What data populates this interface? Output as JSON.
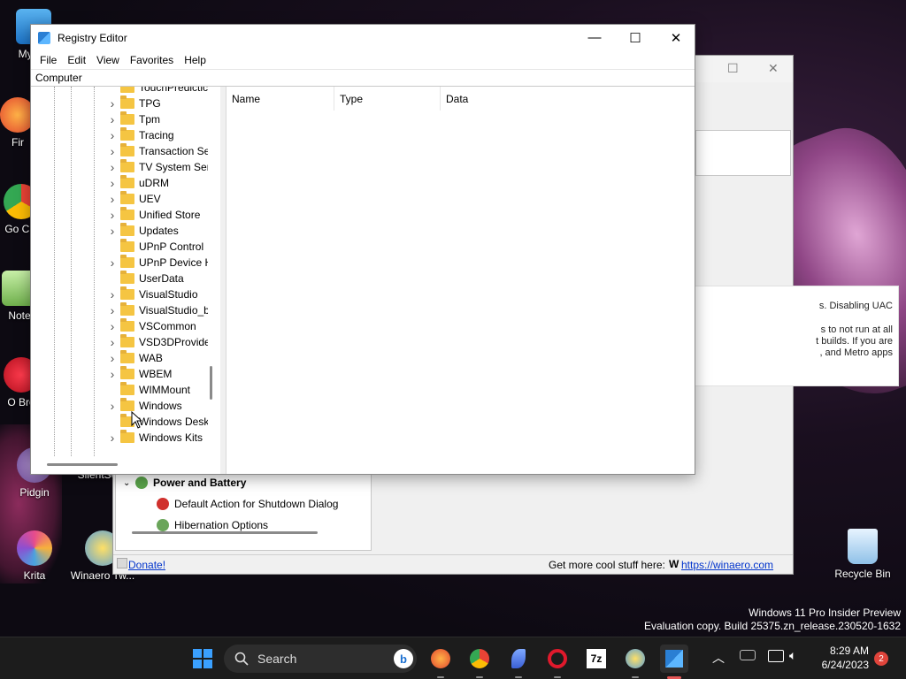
{
  "desktop": {
    "icons": [
      {
        "label": "My Co",
        "icon": "this-pc-icon"
      },
      {
        "label": "Fir",
        "icon": "firefox-icon"
      },
      {
        "label": "Go Chi",
        "icon": "chrome-icon"
      },
      {
        "label": "Note",
        "icon": "notepad-icon"
      },
      {
        "label": "O Bro",
        "icon": "opera-icon"
      },
      {
        "label": "Pidgin",
        "icon": "pidgin-icon"
      },
      {
        "label": "SilentSe",
        "icon": "app-icon"
      },
      {
        "label": "Krita",
        "icon": "krita-icon"
      },
      {
        "label": "Winaero Tw...",
        "icon": "winaero-icon"
      },
      {
        "label": "Recycle Bin",
        "icon": "recycle-bin-icon"
      }
    ],
    "watermark": {
      "line1": "Windows 11 Pro Insider Preview",
      "line2": "Evaluation copy. Build 25375.zn_release.230520-1632"
    }
  },
  "back_window": {
    "tree_section": "Power and Battery",
    "tree_items": [
      "Default Action for Shutdown Dialog",
      "Hibernation Options"
    ],
    "info_text": {
      "line1": "s. Disabling UAC",
      "line2": "s to not run at all",
      "line3": "t builds. If you are",
      "line4": ", and Metro apps"
    },
    "status_left": "Donate!",
    "status_right_text": "Get more cool stuff here:",
    "status_right_link": "https://winaero.com"
  },
  "registry_editor": {
    "title": "Registry Editor",
    "controls": {
      "minimize": "—",
      "maximize": "☐",
      "close": "✕"
    },
    "menu": [
      "File",
      "Edit",
      "View",
      "Favorites",
      "Help"
    ],
    "address": "Computer",
    "tree": [
      {
        "label": "TouchPredictic",
        "expandable": false
      },
      {
        "label": "TPG",
        "expandable": true
      },
      {
        "label": "Tpm",
        "expandable": true
      },
      {
        "label": "Tracing",
        "expandable": true
      },
      {
        "label": "Transaction Se",
        "expandable": true
      },
      {
        "label": "TV System Serv",
        "expandable": true
      },
      {
        "label": "uDRM",
        "expandable": true
      },
      {
        "label": "UEV",
        "expandable": true
      },
      {
        "label": "Unified Store",
        "expandable": true
      },
      {
        "label": "Updates",
        "expandable": true
      },
      {
        "label": "UPnP Control",
        "expandable": false
      },
      {
        "label": "UPnP Device H",
        "expandable": true
      },
      {
        "label": "UserData",
        "expandable": false
      },
      {
        "label": "VisualStudio",
        "expandable": true
      },
      {
        "label": "VisualStudio_b",
        "expandable": true
      },
      {
        "label": "VSCommon",
        "expandable": true
      },
      {
        "label": "VSD3DProvide",
        "expandable": true
      },
      {
        "label": "WAB",
        "expandable": true
      },
      {
        "label": "WBEM",
        "expandable": true
      },
      {
        "label": "WIMMount",
        "expandable": false
      },
      {
        "label": "Windows",
        "expandable": true
      },
      {
        "label": "Windows Desk",
        "expandable": false
      },
      {
        "label": "Windows Kits",
        "expandable": true
      }
    ],
    "columns": [
      "Name",
      "Type",
      "Data"
    ]
  },
  "taskbar": {
    "search_placeholder": "Search",
    "apps": [
      "start-icon",
      "firefox-icon",
      "chrome-icon",
      "feather-icon",
      "opera-icon",
      "7zip-icon",
      "winaero-icon",
      "regedit-icon"
    ],
    "time": "8:29 AM",
    "date": "6/24/2023",
    "notification_count": "2",
    "colors": {
      "accent": "#0078d4",
      "badge": "#e0443b"
    }
  }
}
